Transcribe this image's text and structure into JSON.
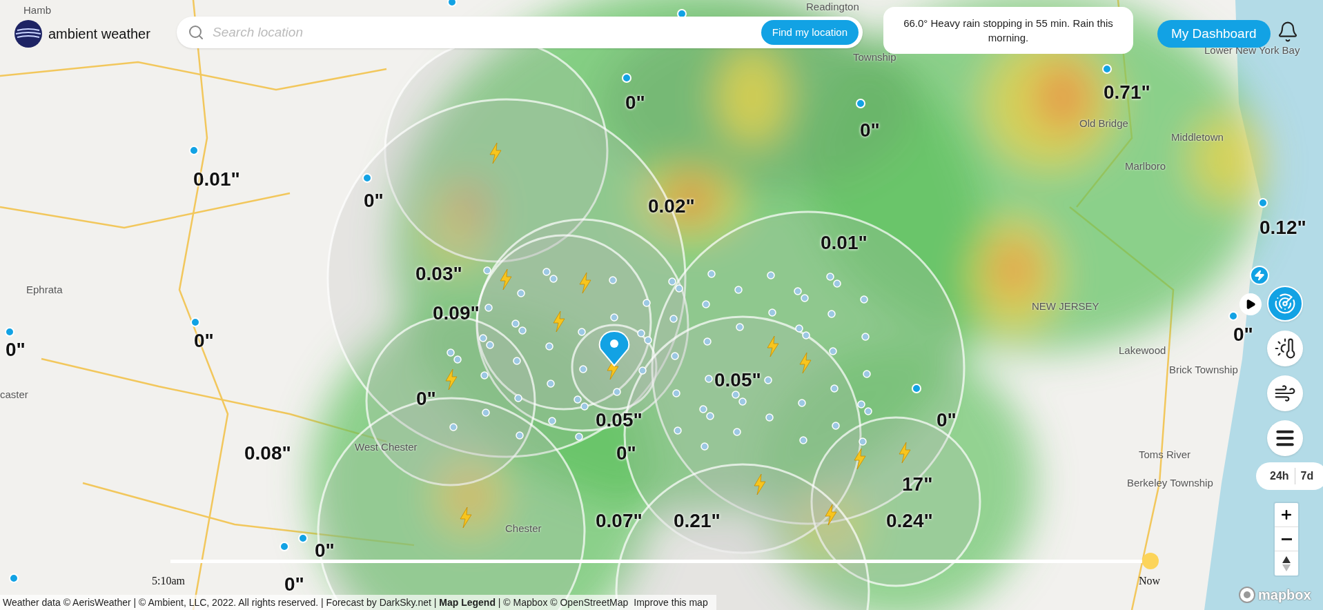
{
  "header": {
    "logo_text": "ambient weather",
    "search": {
      "placeholder": "Search location"
    },
    "find_button": "Find my location"
  },
  "forecast": "66.0° Heavy rain stopping in 55 min. Rain this morning.",
  "dashboard_button": "My Dashboard",
  "map": {
    "places": [
      "Hamb",
      "Readington",
      "Township",
      "Lower New York Bay",
      "Old Bridge",
      "Middletown",
      "Marlboro",
      "Ephrata",
      "NEW JERSEY",
      "caster",
      "Lakewood",
      "Brick Township",
      "West Chester",
      "Toms River",
      "Berkeley Township",
      "Chester"
    ],
    "rainfall": [
      "0.01\"",
      "0\"",
      "0\"",
      "0.71\"",
      "0.02\"",
      "0.12\"",
      "0\"",
      "0.01\"",
      "0.03\"",
      "0.09\"",
      "0\"",
      "0\"",
      "0\"",
      "0.05\"",
      "0\"",
      "0.05\"",
      "0\"",
      "0.08\"",
      "0\"",
      "17\"",
      "0.07\"",
      "0.21\"",
      "0.24\"",
      "0\"",
      "0\""
    ]
  },
  "layers": [
    {
      "kind": "radar",
      "selected": true
    },
    {
      "kind": "temperature",
      "selected": false
    },
    {
      "kind": "wind",
      "selected": false
    },
    {
      "kind": "menu",
      "selected": false
    }
  ],
  "range_options": [
    "24h",
    "7d"
  ],
  "timeline": {
    "start": "5:10am",
    "end": "Now",
    "level": 1
  },
  "footer": {
    "text": "Weather data © AerisWeather | © Ambient, LLC, 2022. All rights reserved. | Forecast by DarkSky.net | **Map Legend** | © Mapbox © OpenStreetMap",
    "link": "Improve this map"
  },
  "mapbox_logo": "mapbox"
}
